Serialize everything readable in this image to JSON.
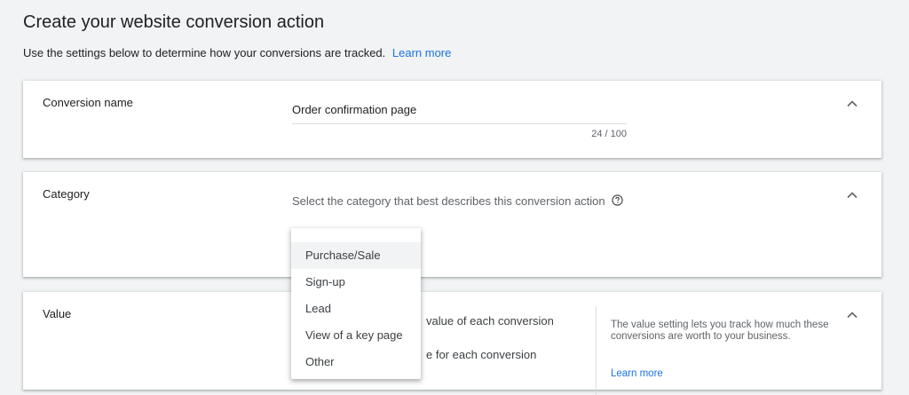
{
  "page": {
    "title": "Create your website conversion action",
    "subtitle": "Use the settings below to determine how your conversions are tracked.",
    "learn_more": "Learn more"
  },
  "conversion_name": {
    "label": "Conversion name",
    "value": "Order confirmation page",
    "char_count": "24 / 100"
  },
  "category": {
    "label": "Category",
    "prompt": "Select the category that best describes this conversion action",
    "options": [
      "Purchase/Sale",
      "Sign-up",
      "Lead",
      "View of a key page",
      "Other"
    ],
    "highlighted": "Purchase/Sale"
  },
  "value": {
    "label": "Value",
    "option_1_partial": "value of each conversion",
    "option_2_partial": "e for each conversion",
    "option_3_partial": "",
    "help_text": "The value setting lets you track how much these conversions are worth to your business.",
    "help_link": "Learn more"
  },
  "colors": {
    "accent": "#1a73e8",
    "background": "#f1f3f4"
  }
}
